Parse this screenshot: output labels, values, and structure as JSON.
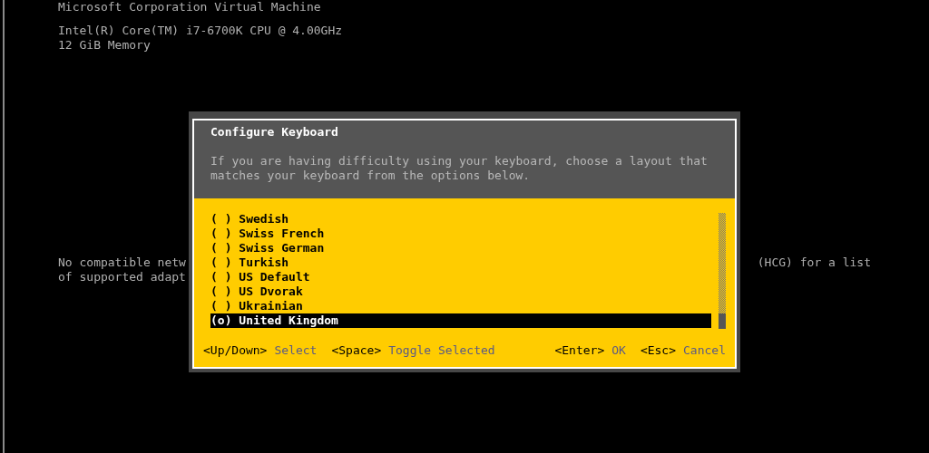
{
  "console": {
    "header_lines": [
      "Microsoft Corporation Virtual Machine",
      "Intel(R) Core(TM) i7-6700K CPU @ 4.00GHz",
      "12 GiB Memory"
    ],
    "notice_left": [
      "No compatible netw",
      "of supported adapt"
    ],
    "notice_right": [
      "(HCG) for a list"
    ]
  },
  "dialog": {
    "title": "Configure Keyboard",
    "description": "If you are having difficulty using your keyboard, choose a layout that matches your keyboard from the options below.",
    "options": [
      {
        "marker": "( )",
        "label": "Swedish",
        "selected": false
      },
      {
        "marker": "( )",
        "label": "Swiss French",
        "selected": false
      },
      {
        "marker": "( )",
        "label": "Swiss German",
        "selected": false
      },
      {
        "marker": "( )",
        "label": "Turkish",
        "selected": false
      },
      {
        "marker": "( )",
        "label": "US Default",
        "selected": false
      },
      {
        "marker": "( )",
        "label": "US Dvorak",
        "selected": false
      },
      {
        "marker": "( )",
        "label": "Ukrainian",
        "selected": false
      },
      {
        "marker": "(o)",
        "label": "United Kingdom",
        "selected": true
      }
    ],
    "hints_left": [
      {
        "key": "<Up/Down>",
        "action": "Select"
      },
      {
        "key": "<Space>",
        "action": "Toggle Selected"
      }
    ],
    "hints_right": [
      {
        "key": "<Enter>",
        "action": "OK"
      },
      {
        "key": "<Esc>",
        "action": "Cancel"
      }
    ]
  }
}
